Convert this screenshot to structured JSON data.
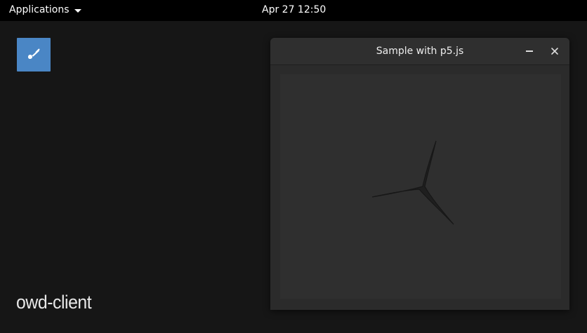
{
  "topbar": {
    "applications_label": "Applications",
    "clock": "Apr 27  12:50"
  },
  "desktop": {
    "launcher_icon": "paint-brush-icon",
    "label": "owd-client"
  },
  "window": {
    "title": "Sample with p5.js",
    "icons": [
      "minimize-icon",
      "close-icon"
    ]
  }
}
